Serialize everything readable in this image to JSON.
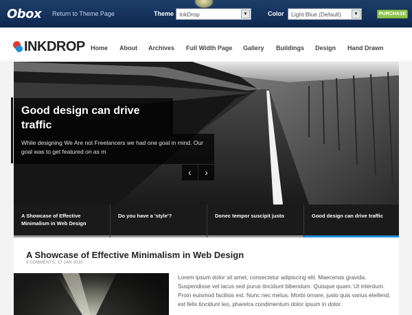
{
  "topbar": {
    "logo": "Obox",
    "return_link": "Return to Theme Page",
    "theme_label": "Theme",
    "theme_value": "InkDrop",
    "color_label": "Color",
    "color_value": "Light Blue (Default)",
    "purchase": "PURCHASE"
  },
  "header": {
    "logo": "INKDROP",
    "nav": [
      "Home",
      "About",
      "Archives",
      "Full Width Page",
      "Gallery",
      "Buildings",
      "Design",
      "Hand Drawn"
    ]
  },
  "slider": {
    "title": "Good design can drive traffic",
    "text": "While designing We Are not Freelancers we had one goal in mind. Our goal was to get featured on as m",
    "prev": "‹",
    "next": "›"
  },
  "tabs": [
    {
      "label": "A Showcase of Effective Minimalism in Web Design",
      "active": false
    },
    {
      "label": "Do you have a 'style'?",
      "active": false
    },
    {
      "label": "Donec tempor suscipit justo",
      "active": false
    },
    {
      "label": "Good design can drive traffic",
      "active": true
    }
  ],
  "post": {
    "title": "A Showcase of Effective Minimalism in Web Design",
    "meta": "6 COMMENTS, 17 JAN 2010",
    "body": "Lorem ipsum dolor sit amet, consectetur adipiscing elit. Maecenas gravida. Suspendisse vel lacus sed purus tincidunt bibendum. Quisque quam. Ut interdum. Proin euismod facilisis est. Nunc nec metus. Morbi ornare, justo quis varius eleifend, est felis tincidunt leo, pharetra condimentum dolor ipsum in dolor."
  },
  "colors": {
    "accent": "#1f8fd6",
    "purchase": "#8fc44a",
    "topbar": "#1d3e6b"
  }
}
